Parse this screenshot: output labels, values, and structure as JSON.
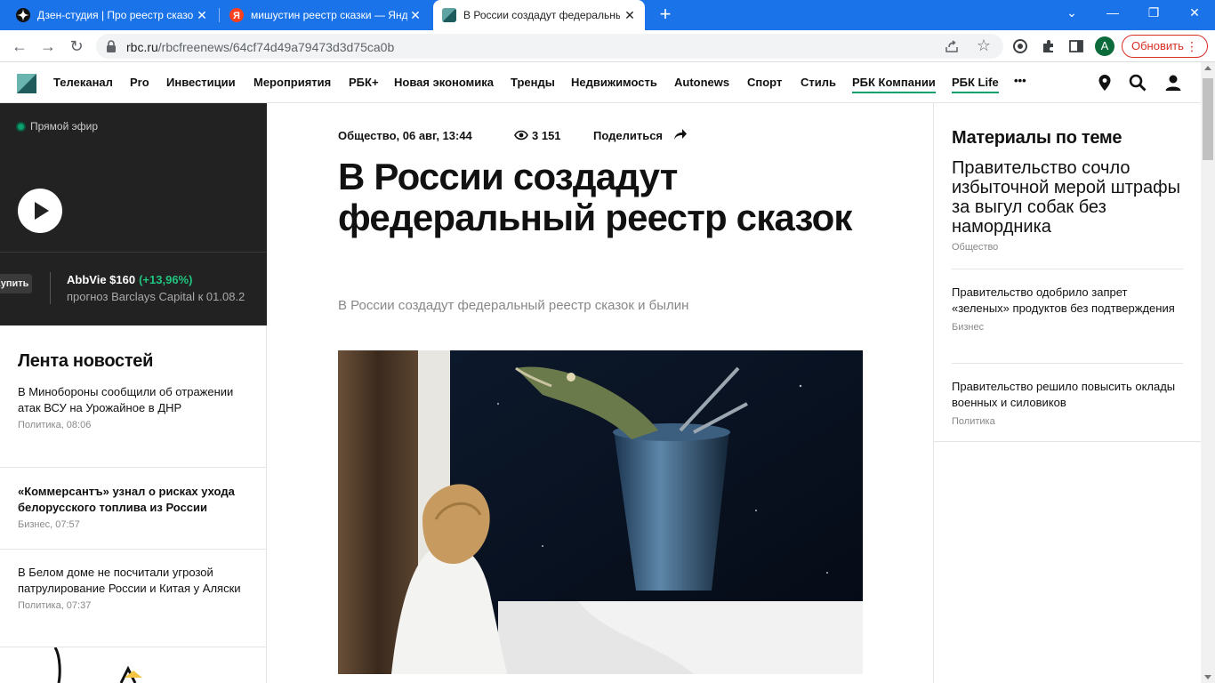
{
  "browser": {
    "tabs": [
      {
        "title": "Дзен-студия | Про реестр сказо",
        "icon": "zen-icon"
      },
      {
        "title": "мишустин реестр сказки — Янд",
        "icon": "yandex-icon"
      },
      {
        "title": "В России создадут федеральны",
        "icon": "rbc-icon"
      }
    ],
    "url_host": "rbc.ru",
    "url_path": "/rbcfreenews/64cf74d49a79473d3d75ca0b",
    "profile_initial": "A",
    "update_label": "Обновить",
    "colors": {
      "tabbar": "#1a73e8",
      "update": "#d93025",
      "accent": "#0e9f6e"
    }
  },
  "header": {
    "nav": [
      "Телеканал",
      "Pro",
      "Инвестиции",
      "Мероприятия",
      "РБК+",
      "Новая экономика",
      "Тренды",
      "Недвижимость",
      "Autonews",
      "Спорт",
      "Стиль",
      "РБК Компании",
      "РБК Life"
    ],
    "more": "•••"
  },
  "live": {
    "label": "Прямой эфир",
    "ticker": {
      "button": "Купить",
      "name": "AbbVie $160",
      "change": "(+13,96%)",
      "note": "прогноз Barclays Capital к 01.08.2"
    }
  },
  "feed": {
    "title": "Лента новостей",
    "items": [
      {
        "text": "В Минобороны сообщили об отражении атак ВСУ на Урожайное в ДНР",
        "meta": "Политика, 08:06"
      },
      {
        "text": "«Коммерсантъ» узнал о рисках ухода белорусского топлива из России",
        "meta": "Бизнес, 07:57"
      },
      {
        "text": "В Белом доме не посчитали угрозой патрулирование России и Китая у Аляски",
        "meta": "Политика, 07:37"
      }
    ]
  },
  "article": {
    "meta": "Общество, 06 авг, 13:44",
    "views": "3 151",
    "share": "Поделиться",
    "headline": "В России создадут федеральный реестр сказок",
    "subtitle": "В России создадут федеральный реестр сказок и былин"
  },
  "related": {
    "title": "Материалы по теме",
    "items": [
      {
        "text": "Правительство сочло избыточной мерой штрафы за выгул собак без намордника",
        "meta": "Общество"
      },
      {
        "text": "Правительство одобрило запрет «зеленых» продуктов без подтверждения",
        "meta": "Бизнес"
      },
      {
        "text": "Правительство решило повысить оклады военных и силовиков",
        "meta": "Политика"
      }
    ]
  }
}
